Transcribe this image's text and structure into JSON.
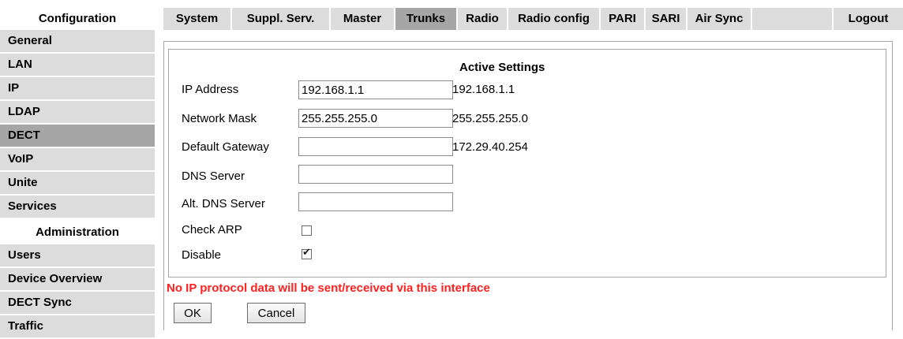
{
  "sidebar": {
    "config_heading": "Configuration",
    "config_items": [
      {
        "label": "General",
        "active": false
      },
      {
        "label": "LAN",
        "active": false
      },
      {
        "label": "IP",
        "active": false
      },
      {
        "label": "LDAP",
        "active": false
      },
      {
        "label": "DECT",
        "active": true
      },
      {
        "label": "VoIP",
        "active": false
      },
      {
        "label": "Unite",
        "active": false
      },
      {
        "label": "Services",
        "active": false
      }
    ],
    "admin_heading": "Administration",
    "admin_items": [
      {
        "label": "Users"
      },
      {
        "label": "Device Overview"
      },
      {
        "label": "DECT Sync"
      },
      {
        "label": "Traffic"
      }
    ]
  },
  "tabs": [
    {
      "label": "System",
      "active": false
    },
    {
      "label": "Suppl. Serv.",
      "active": false
    },
    {
      "label": "Master",
      "active": false
    },
    {
      "label": "Trunks",
      "active": true
    },
    {
      "label": "Radio",
      "active": false
    },
    {
      "label": "Radio config",
      "active": false
    },
    {
      "label": "PARI",
      "active": false
    },
    {
      "label": "SARI",
      "active": false
    },
    {
      "label": "Air Sync",
      "active": false
    },
    {
      "label": "",
      "active": false
    },
    {
      "label": "Logout",
      "active": false
    }
  ],
  "form": {
    "active_heading": "Active Settings",
    "ip_address": {
      "label": "IP Address",
      "value": "192.168.1.1",
      "active": "192.168.1.1"
    },
    "network_mask": {
      "label": "Network Mask",
      "value": "255.255.255.0",
      "active": "255.255.255.0"
    },
    "default_gateway": {
      "label": "Default Gateway",
      "value": "",
      "active": "172.29.40.254"
    },
    "dns_server": {
      "label": "DNS Server",
      "value": ""
    },
    "alt_dns_server": {
      "label": "Alt. DNS Server",
      "value": ""
    },
    "check_arp": {
      "label": "Check ARP",
      "checked": false
    },
    "disable": {
      "label": "Disable",
      "checked": true
    },
    "warning": "No IP protocol data will be sent/received via this interface",
    "ok_label": "OK",
    "cancel_label": "Cancel"
  },
  "colors": {
    "item_bg": "#dcdcdc",
    "active_bg": "#a6a6a6",
    "warning": "#ff2020"
  }
}
